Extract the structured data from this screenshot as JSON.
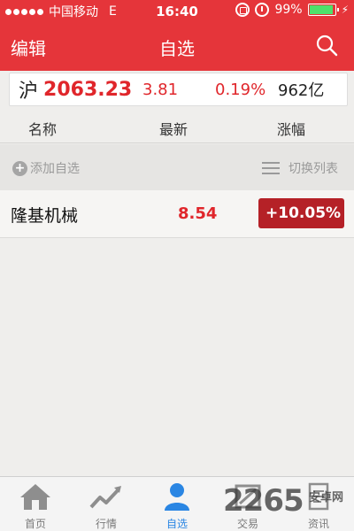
{
  "status_bar": {
    "carrier": "中国移动",
    "network": "E",
    "time": "16:40",
    "battery_percent": "99%",
    "battery_level": 0.99,
    "icons": [
      "signal-icon",
      "rotation-lock-icon",
      "alarm-icon",
      "battery-icon",
      "charging-icon"
    ]
  },
  "nav": {
    "left_label": "编辑",
    "title": "自选",
    "right_icon": "search-icon"
  },
  "index": {
    "name": "沪",
    "value": "2063.23",
    "change": "3.81",
    "change_pct": "0.19%",
    "volume": "962亿"
  },
  "columns": {
    "name": "名称",
    "latest": "最新",
    "change": "涨幅"
  },
  "actions": {
    "add_label": "添加自选",
    "switch_label": "切换列表"
  },
  "stocks": [
    {
      "name": "隆基机械",
      "price": "8.54",
      "sign": "+",
      "change_pct": "10.05%"
    }
  ],
  "tabs": [
    {
      "label": "首页",
      "icon": "home-icon",
      "active": false
    },
    {
      "label": "行情",
      "icon": "chart-icon",
      "active": false
    },
    {
      "label": "自选",
      "icon": "user-icon",
      "active": true
    },
    {
      "label": "交易",
      "icon": "trade-icon",
      "active": false
    },
    {
      "label": "资讯",
      "icon": "news-icon",
      "active": false
    }
  ],
  "watermark": {
    "text": "2265",
    "sub": "安卓网"
  },
  "colors": {
    "brand_red": "#e5353a",
    "up_red": "#e0262b",
    "badge_red": "#b52127",
    "active_blue": "#2a86e3"
  }
}
